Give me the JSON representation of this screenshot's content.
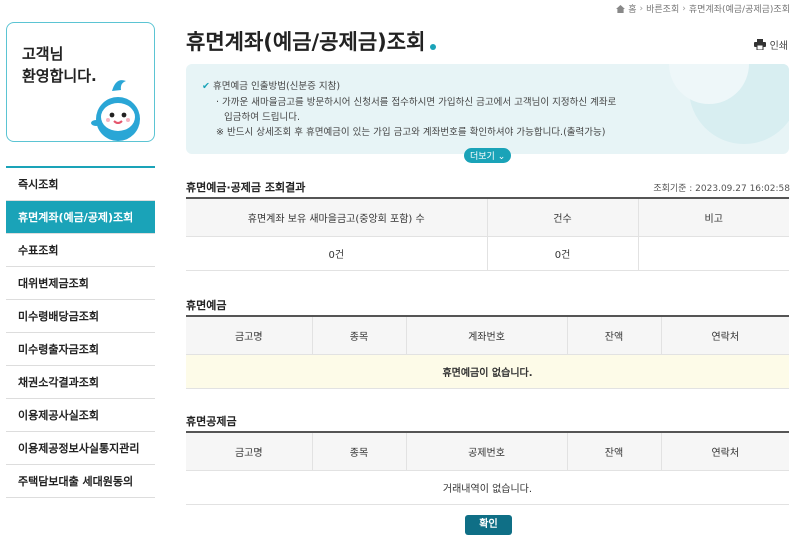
{
  "breadcrumb": {
    "home_icon": "home-icon",
    "items": [
      "홈",
      "바른조회",
      "휴면계좌(예금/공제금)조회"
    ]
  },
  "sidebar": {
    "welcome_line1": "고객님",
    "welcome_line2": "환영합니다.",
    "items": [
      {
        "label": "즉시조회"
      },
      {
        "label": "휴면계좌(예금/공제)조회",
        "active": true
      },
      {
        "label": "수표조회"
      },
      {
        "label": "대위변제금조회"
      },
      {
        "label": "미수령배당금조회"
      },
      {
        "label": "미수령출자금조회"
      },
      {
        "label": "채권소각결과조회"
      },
      {
        "label": "이용제공사실조회"
      },
      {
        "label": "이용제공정보사실통지관리"
      },
      {
        "label": "주택담보대출 세대원동의"
      }
    ]
  },
  "main": {
    "title": "휴면계좌(예금/공제금)조회",
    "print_label": "인쇄",
    "info": {
      "line1": "휴면예금 인출방법(신분증 지참)",
      "line2": "· 가까운 새마을금고를 방문하시어 신청서를 접수하시면 가입하신 금고에서 고객님이 지정하신 계좌로",
      "line3": "입금하여 드립니다.",
      "line4": "※ 반드시 상세조회 후 휴면예금이 있는 가입 금고와 계좌번호를 확인하셔야 가능합니다.(출력가능)",
      "more_label": "더보기"
    },
    "result": {
      "title": "휴면예금·공제금 조회결과",
      "query_time": "조회기준 : 2023.09.27 16:02:58",
      "headers": [
        "휴면계좌 보유 새마을금고(중앙회 포함) 수",
        "건수",
        "비고"
      ],
      "row": [
        "0건",
        "0건",
        ""
      ]
    },
    "deposit": {
      "title": "휴면예금",
      "headers": [
        "금고명",
        "종목",
        "계좌번호",
        "잔액",
        "연락처"
      ],
      "empty_message": "휴면예금이 없습니다."
    },
    "mutual": {
      "title": "휴면공제금",
      "headers": [
        "금고명",
        "종목",
        "공제번호",
        "잔액",
        "연락처"
      ],
      "empty_message": "거래내역이 없습니다."
    },
    "confirm_label": "확인"
  },
  "colors": {
    "accent": "#1aa3b8",
    "button": "#0f6f86",
    "info_bg": "#e7f4f6",
    "empty_bg": "#fdfbe8"
  }
}
